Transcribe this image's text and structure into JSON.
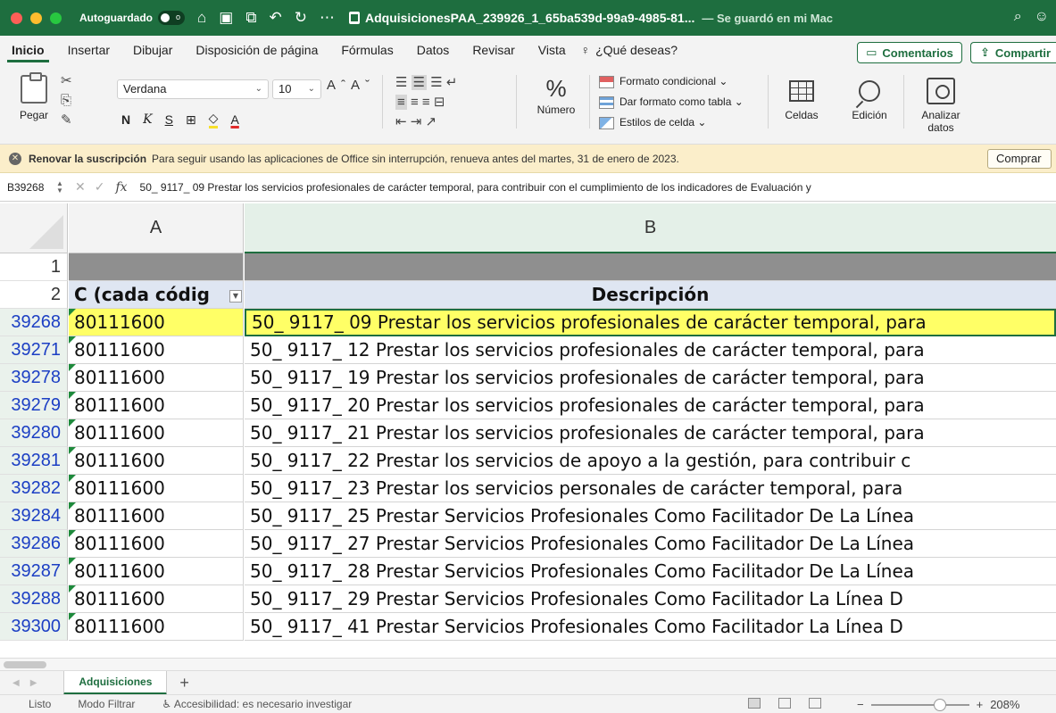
{
  "titlebar": {
    "autosave_label": "Autoguardado",
    "autosave_state": "o",
    "doc_title": "AdquisicionesPAA_239926_1_65ba539d-99a9-4985-81...",
    "saved_status": "— Se guardó en mi Mac"
  },
  "tabs": [
    "Inicio",
    "Insertar",
    "Dibujar",
    "Disposición de página",
    "Fórmulas",
    "Datos",
    "Revisar",
    "Vista"
  ],
  "tell_me": "¿Qué deseas?",
  "buttons": {
    "comments": "Comentarios",
    "share": "Compartir"
  },
  "ribbon": {
    "paste": "Pegar",
    "font_name": "Verdana",
    "font_size": "10",
    "bold": "N",
    "italic": "K",
    "underline": "S",
    "number": "Número",
    "cond_format": "Formato condicional",
    "format_table": "Dar formato como tabla",
    "cell_styles": "Estilos de celda",
    "cells": "Celdas",
    "editing": "Edición",
    "analyze": "Analizar datos"
  },
  "notice": {
    "title": "Renovar la suscripción",
    "text": "Para seguir usando las aplicaciones de Office sin interrupción, renueva antes del martes, 31 de enero de 2023.",
    "button": "Comprar"
  },
  "formula_bar": {
    "name_box": "B39268",
    "content": "50_ 9117_ 09 Prestar los servicios profesionales de carácter temporal, para contribuir con el cumplimiento de los indicadores de Evaluación y"
  },
  "columns": [
    "A",
    "B"
  ],
  "header_row": {
    "num1": "1",
    "num2": "2",
    "colA": "C (cada códig",
    "colB": "Descripción"
  },
  "rows": [
    {
      "num": "39268",
      "a": "80111600",
      "b": "50_ 9117_ 09 Prestar los servicios profesionales de carácter temporal, para"
    },
    {
      "num": "39271",
      "a": "80111600",
      "b": "50_ 9117_ 12 Prestar los servicios profesionales de carácter temporal, para"
    },
    {
      "num": "39278",
      "a": "80111600",
      "b": "50_ 9117_ 19 Prestar los servicios profesionales de carácter temporal, para"
    },
    {
      "num": "39279",
      "a": "80111600",
      "b": "50_ 9117_ 20 Prestar los servicios profesionales de carácter temporal, para"
    },
    {
      "num": "39280",
      "a": "80111600",
      "b": "50_ 9117_ 21 Prestar los servicios profesionales de carácter temporal, para"
    },
    {
      "num": "39281",
      "a": "80111600",
      "b": "50_ 9117_ 22 Prestar los servicios de apoyo a la gestión, para contribuir c"
    },
    {
      "num": "39282",
      "a": "80111600",
      "b": "50_ 9117_ 23 Prestar los servicios personales de carácter temporal, para"
    },
    {
      "num": "39284",
      "a": "80111600",
      "b": "50_ 9117_ 25  Prestar Servicios Profesionales Como Facilitador De La Línea"
    },
    {
      "num": "39286",
      "a": "80111600",
      "b": "50_ 9117_ 27 Prestar Servicios Profesionales Como Facilitador De La Línea"
    },
    {
      "num": "39287",
      "a": "80111600",
      "b": "50_ 9117_ 28 Prestar Servicios Profesionales Como Facilitador De La Línea"
    },
    {
      "num": "39288",
      "a": "80111600",
      "b": "50_ 9117_ 29  Prestar Servicios Profesionales Como Facilitador La Línea D"
    },
    {
      "num": "39300",
      "a": "80111600",
      "b": "50_ 9117_ 41  Prestar Servicios Profesionales Como Facilitador La Línea D"
    }
  ],
  "sheet_tab": "Adquisiciones",
  "status": {
    "ready": "Listo",
    "filter": "Modo Filtrar",
    "accessibility": "Accesibilidad: es necesario investigar",
    "zoom": "208%"
  }
}
